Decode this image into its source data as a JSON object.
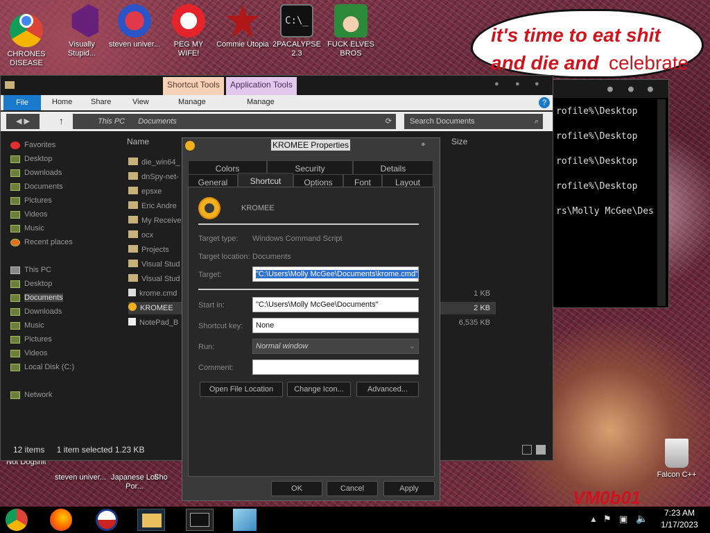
{
  "desktop": {
    "icons": [
      {
        "label": "CHRONES DISEASE",
        "icon": "chrome-icon"
      },
      {
        "label": "Visually Stupid...",
        "icon": "visual-studio-icon"
      },
      {
        "label": "steven univer...",
        "icon": "steven-universe-icon"
      },
      {
        "label": "PEG MY WIFE!",
        "icon": "peg-icon"
      },
      {
        "label": "Commie Utopia",
        "icon": "commie-icon"
      },
      {
        "label": "2PACALYPSE 2.3",
        "icon": "terminal-icon"
      },
      {
        "label": "FUCK ELVES BROS",
        "icon": "elf-icon"
      },
      {
        "label": "Not Dogshit",
        "icon": "app-icon"
      },
      {
        "label": "steven univer...",
        "icon": "app-icon"
      },
      {
        "label": "Japanese Loli Por...",
        "icon": "app-icon"
      },
      {
        "label": "Sho",
        "icon": "app-icon"
      },
      {
        "label": "Falcon C++",
        "icon": "recycle-bin-icon"
      }
    ],
    "speech_line1": "it's time to eat shit",
    "speech_line2a": "and die and",
    "speech_line2b": "celebrate",
    "watermark": "VM0b01"
  },
  "explorer": {
    "context_tabs": [
      "Shortcut Tools",
      "Application Tools"
    ],
    "ribbon": [
      "File",
      "Home",
      "Share",
      "View",
      "Manage",
      "Manage"
    ],
    "breadcrumb": [
      "This PC",
      "Documents"
    ],
    "search_placeholder": "Search Documents",
    "nav": [
      "Favorites",
      "Desktop",
      "Downloads",
      "Documents",
      "Pictures",
      "Videos",
      "Music",
      "Recent places",
      "This PC",
      "Desktop",
      "Documents",
      "Downloads",
      "Music",
      "Pictures",
      "Videos",
      "Local Disk (C:)",
      "Network"
    ],
    "col_name": "Name",
    "col_size": "Size",
    "files": [
      {
        "name": "die_win64_",
        "size": ""
      },
      {
        "name": "dnSpy-net-",
        "size": ""
      },
      {
        "name": "epsxe",
        "size": ""
      },
      {
        "name": "Eric Andre",
        "size": ""
      },
      {
        "name": "My Receive",
        "size": ""
      },
      {
        "name": "ocx",
        "size": ""
      },
      {
        "name": "Projects",
        "size": ""
      },
      {
        "name": "Visual Stud",
        "size": ""
      },
      {
        "name": "Visual Stud",
        "size": ""
      },
      {
        "name": "krome.cmd",
        "size": "1 KB"
      },
      {
        "name": "KROMEE",
        "size": "2 KB"
      },
      {
        "name": "NotePad_B",
        "size": "6,535 KB"
      }
    ],
    "status_items": "12 items",
    "status_selected": "1 item selected  1.23 KB"
  },
  "cmd": {
    "lines": [
      "rofile%\\Desktop",
      "rofile%\\Desktop",
      "rofile%\\Desktop",
      "rofile%\\Desktop",
      "rs\\Molly McGee\\Des"
    ]
  },
  "dialog": {
    "title": "KROMEE Properties",
    "tabs_top": [
      "Colors",
      "Security",
      "Details"
    ],
    "tabs_bottom": [
      "General",
      "Shortcut",
      "Options",
      "Font",
      "Layout"
    ],
    "name": "KROMEE",
    "target_type_label": "Target type:",
    "target_type": "Windows Command Script",
    "target_location_label": "Target location:",
    "target_location": "Documents",
    "target_label": "Target:",
    "target": "\"C:\\Users\\Molly McGee\\Documents\\krome.cmd\"",
    "start_in_label": "Start in:",
    "start_in": "\"C:\\Users\\Molly McGee\\Documents\"",
    "shortcut_key_label": "Shortcut key:",
    "shortcut_key": "None",
    "run_label": "Run:",
    "run": "Normal window",
    "comment_label": "Comment:",
    "comment": "",
    "btn_open": "Open File Location",
    "btn_icon": "Change Icon...",
    "btn_adv": "Advanced...",
    "ok": "OK",
    "cancel": "Cancel",
    "apply": "Apply"
  },
  "taskbar": {
    "time": "7:23 AM",
    "date": "1/17/2023"
  }
}
